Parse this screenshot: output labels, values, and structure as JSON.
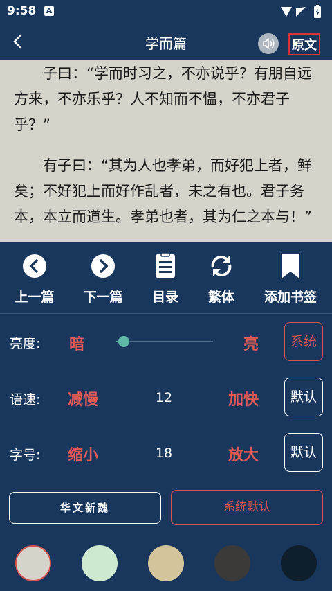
{
  "status_bar": {
    "time": "9:58",
    "notification_letter": "A"
  },
  "header": {
    "title": "学而篇",
    "original_label": "原文"
  },
  "reading": {
    "paragraphs": [
      "子曰：“学而时习之，不亦说乎？有朋自远方来，不亦乐乎？人不知而不愠，不亦君子乎？”",
      "有子曰：“其为人也孝弟，而好犯上者，鲜矣；不好犯上而好作乱者，未之有也。君子务本，本立而道生。孝弟也者，其为仁之本与！”"
    ]
  },
  "toolbar": {
    "prev": "上一篇",
    "next": "下一篇",
    "catalog": "目录",
    "traditional": "繁体",
    "bookmark": "添加书签"
  },
  "brightness": {
    "label": "亮度:",
    "dark": "暗",
    "bright": "亮",
    "button": "系统",
    "level": 0.08
  },
  "speed": {
    "label": "语速:",
    "slower": "减慢",
    "value": "12",
    "faster": "加快",
    "button": "默认"
  },
  "font_size": {
    "label": "字号:",
    "smaller": "缩小",
    "value": "18",
    "bigger": "放大",
    "button": "默认"
  },
  "fonts": {
    "huawen": "华文新魏",
    "system": "系统默认"
  },
  "themes": {
    "colors": [
      "#d5d3ca",
      "#cde9cf",
      "#d4c49c",
      "#3c3a38",
      "#0e1f2b"
    ],
    "selected_index": 0,
    "selected_ring": "#d9534f"
  }
}
